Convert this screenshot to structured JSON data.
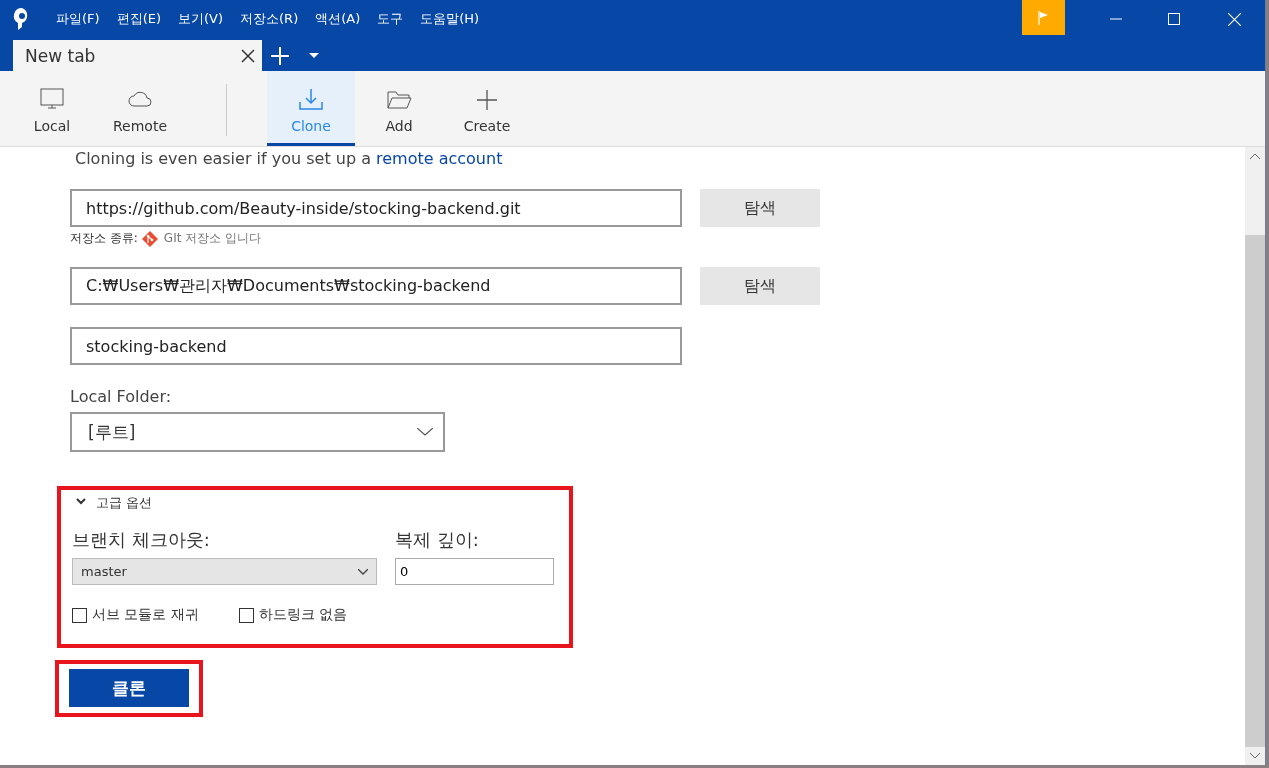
{
  "menu": [
    "파일(F)",
    "편집(E)",
    "보기(V)",
    "저장소(R)",
    "액션(A)",
    "도구",
    "도움말(H)"
  ],
  "tabs": [
    {
      "label": "New tab",
      "selected": true
    }
  ],
  "toolbar": [
    {
      "label": "Local",
      "selected": false
    },
    {
      "label": "Remote",
      "selected": false
    },
    {
      "label": "Clone",
      "selected": true
    },
    {
      "label": "Add",
      "selected": false
    },
    {
      "label": "Create",
      "selected": false
    }
  ],
  "notice": {
    "text": "Cloning is even easier if you set up a",
    "link": "remote account"
  },
  "source": {
    "value": "https://github.com/Beauty-inside/stocking-backend.git",
    "button": "탐색",
    "type_label": "저장소 종류:",
    "type_value": "GIt 저장소 입니다"
  },
  "destination": {
    "value": "C:₩Users₩관리자₩Documents₩stocking-backend",
    "button": "탐색"
  },
  "name": {
    "value": "stocking-backend"
  },
  "local_folder": {
    "label": "Local Folder:",
    "value": "[루트]"
  },
  "advanced": {
    "title": "고급 옵션",
    "expanded": true,
    "highlighted": true,
    "branch_label": "브랜치 체크아웃:",
    "branch": "master",
    "depth_label": "복제 깊이:",
    "depth": "0",
    "options": [
      {
        "label": "서브 모듈로 재귀",
        "checked": false
      },
      {
        "label": "하드링크 없음",
        "checked": false
      }
    ]
  },
  "clone_button": {
    "label": "클론",
    "highlighted": true
  }
}
